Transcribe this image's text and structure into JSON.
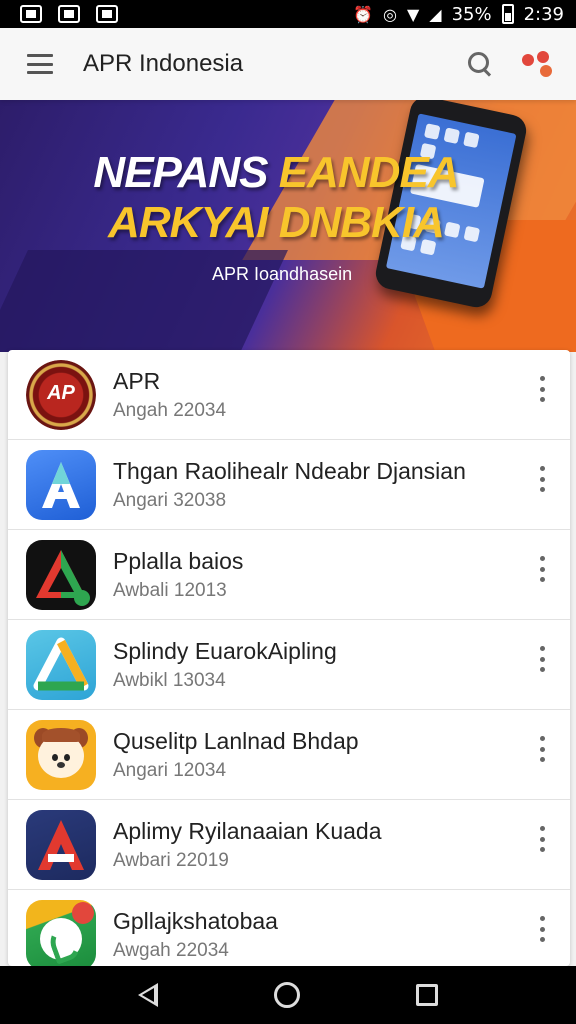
{
  "status_bar": {
    "time": "2:39",
    "battery": "35%",
    "left_icons": [
      "notification-icon",
      "image-icon",
      "message-icon"
    ],
    "right_icons": [
      "alarm-icon",
      "hotspot-icon",
      "wifi-icon",
      "signal-icon",
      "battery-icon"
    ]
  },
  "app_bar": {
    "title": "APR Indonesia",
    "accent_color": "#e2473c"
  },
  "banner": {
    "headline_line1_white": "NEPANS",
    "headline_line1_yellow": "EANDEA",
    "headline_line2": "ARKYAI DNBKIA",
    "subtitle": "APR Ioandhasein"
  },
  "apps": [
    {
      "name": "APR",
      "meta": "Angah 22034",
      "icon": "apr-logo-icon",
      "icon_text": "AP"
    },
    {
      "name": "Thgan Raolihealr Ndeabr Djansian",
      "meta": "Angari 32038",
      "icon": "blue-a-icon",
      "icon_text": "A"
    },
    {
      "name": "Pplalla baios",
      "meta": "Awbali 12013",
      "icon": "black-triangle-icon",
      "icon_text": ""
    },
    {
      "name": "Splindy EuarokAipling",
      "meta": "Awbikl 13034",
      "icon": "teal-triangle-icon",
      "icon_text": ""
    },
    {
      "name": "Quselitp Lanlnad Bhdap",
      "meta": "Angari 12034",
      "icon": "dog-icon",
      "icon_text": ""
    },
    {
      "name": "Aplimy Ryilanaaian Kuada",
      "meta": "Awbari 22019",
      "icon": "navy-a-icon",
      "icon_text": "A"
    },
    {
      "name": "Gpllajkshatobaa",
      "meta": "Awgah 22034",
      "icon": "phone-call-icon",
      "icon_text": ""
    }
  ],
  "nav_bar": {
    "icons": [
      "back-icon",
      "home-icon",
      "recents-icon"
    ]
  }
}
